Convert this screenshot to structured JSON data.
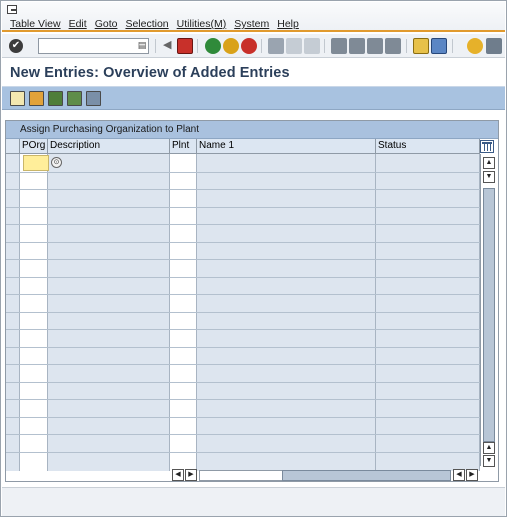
{
  "menu": {
    "items": [
      {
        "label": "Table View"
      },
      {
        "label": "Edit"
      },
      {
        "label": "Goto"
      },
      {
        "label": "Selection"
      },
      {
        "label": "Utilities(M)"
      },
      {
        "label": "System"
      },
      {
        "label": "Help"
      }
    ]
  },
  "toolbar": {
    "command_field_value": "",
    "icons": [
      "enter-icon",
      "save-icon",
      "back-icon",
      "exit-icon",
      "cancel-icon",
      "print-icon",
      "find-icon",
      "find-next-icon",
      "first-page-icon",
      "previous-page-icon",
      "next-page-icon",
      "last-page-icon",
      "create-session-icon",
      "shortcut-icon",
      "help-icon",
      "customize-icon"
    ]
  },
  "page": {
    "title": "New Entries: Overview of Added Entries"
  },
  "app_toolbar": {
    "icons": [
      "change-display-icon",
      "save-entries-icon",
      "select-all-icon",
      "select-block-icon",
      "deselect-all-icon"
    ]
  },
  "table": {
    "title": "Assign Purchasing Organization to Plant",
    "columns": [
      {
        "label": "POrg"
      },
      {
        "label": "Description"
      },
      {
        "label": "Plnt"
      },
      {
        "label": "Name 1"
      },
      {
        "label": "Status"
      }
    ],
    "rows": 17,
    "first_row_porg_value": ""
  },
  "colors": {
    "menu_underline": "#e19a2e",
    "title_text": "#2b3f5a",
    "app_toolbar_bg": "#a8c2e0",
    "input_highlight": "#ffee9a"
  }
}
